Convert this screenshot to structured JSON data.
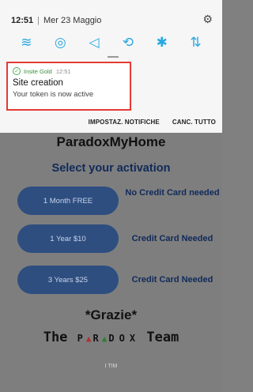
{
  "status_bar": {
    "time": "12:51",
    "separator": "|",
    "date": "Mer 23 Maggio"
  },
  "quick_settings": {
    "icons": [
      "wifi-icon",
      "location-icon",
      "sound-icon",
      "auto-rotate-icon",
      "bluetooth-icon",
      "data-transfer-icon"
    ],
    "glyphs": [
      "≋",
      "◎",
      "◁",
      "⟲",
      "✱",
      "⇅"
    ],
    "accent_color": "#29a9e0"
  },
  "notification": {
    "app_name": "Insite Gold",
    "time": "12:51",
    "title": "Site creation",
    "body": "Your token is now active",
    "highlight_color": "#e53935"
  },
  "shade_actions": {
    "settings_label": "IMPOSTAZ. NOTIFICHE",
    "clear_all_label": "CANC. TUTTO"
  },
  "app": {
    "title": "ParadoxMyHome",
    "subtitle": "Select your activation",
    "plans": [
      {
        "button_label": "1 Month FREE",
        "note": "No Credit Card needed"
      },
      {
        "button_label": "1 Year   $10",
        "note": "Credit Card Needed"
      },
      {
        "button_label": "3 Years   $25",
        "note": "Credit Card Needed"
      }
    ],
    "thanks": "*Grazie*",
    "team_prefix": "The",
    "team_brand": [
      "P",
      "▲",
      "R",
      "▲",
      "D",
      "O",
      "X"
    ],
    "team_suffix": "Team",
    "carrier": "I TIM",
    "brand_button_color": "#2e4e80"
  }
}
